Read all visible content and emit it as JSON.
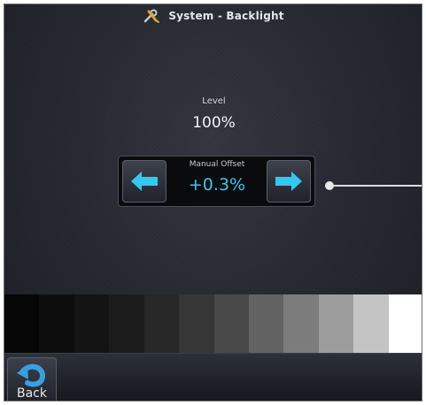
{
  "window": {
    "title": "System - Backlight",
    "title_icon": "wrench-screwdriver-icon"
  },
  "level": {
    "label": "Level",
    "value": "100%"
  },
  "manual_offset": {
    "label": "Manual Offset",
    "value": "+0.3%",
    "decrease_icon": "arrow-left-icon",
    "increase_icon": "arrow-right-icon",
    "accent_color": "#35c8ee"
  },
  "gray_scale": {
    "swatches": [
      "#060606",
      "#0d0d0d",
      "#141414",
      "#1b1b1b",
      "#272727",
      "#363636",
      "#494949",
      "#626262",
      "#7c7c7c",
      "#9c9c9c",
      "#c4c4c4",
      "#ffffff"
    ]
  },
  "nav": {
    "back_label": "Back",
    "back_icon": "back-arrow-icon"
  }
}
